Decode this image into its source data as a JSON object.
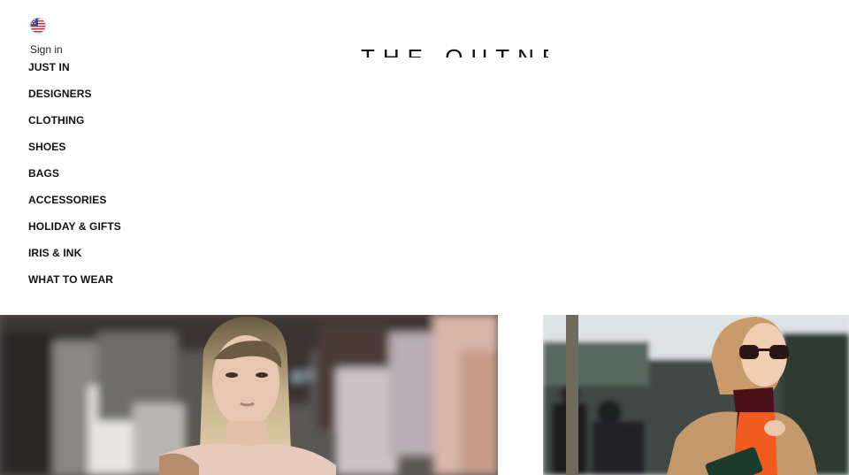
{
  "header": {
    "country_flag_icon": "us-flag-icon",
    "sign_in_label": "Sign in",
    "logo_text": "THE OUTNET"
  },
  "nav": {
    "items": [
      {
        "label": "JUST IN"
      },
      {
        "label": "DESIGNERS"
      },
      {
        "label": "CLOTHING"
      },
      {
        "label": "SHOES"
      },
      {
        "label": "BAGS"
      },
      {
        "label": "ACCESSORIES"
      },
      {
        "label": "HOLIDAY & GIFTS"
      },
      {
        "label": "IRIS & INK"
      },
      {
        "label": "WHAT TO WEAR"
      }
    ]
  },
  "colors": {
    "background": "#ffffff",
    "text": "#111111",
    "coat_camel": "#c49a6c",
    "sweater_orange": "#f05a1e"
  }
}
